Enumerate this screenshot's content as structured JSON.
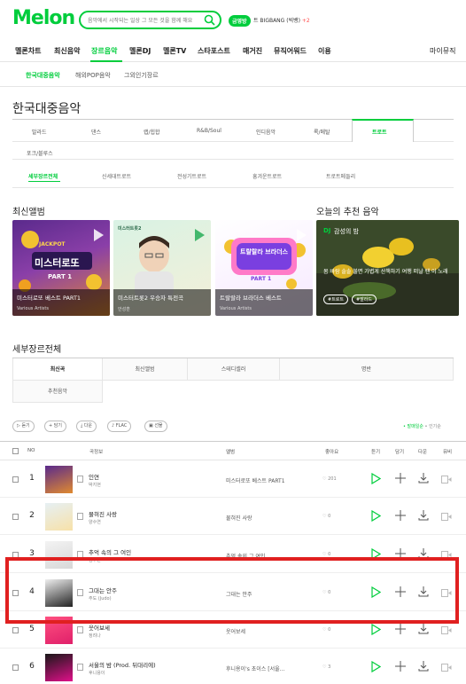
{
  "header": {
    "logo": "Melon",
    "search_placeholder": "음악에서 시작되는 일상 그 모든 것을 함께 해요",
    "promo_badge": "금영방",
    "promo_text": "트 BIGBANG (빅뱅)",
    "promo_new": "+2"
  },
  "gnb": {
    "items": [
      "멜론차트",
      "최신음악",
      "장르음악",
      "멜론DJ",
      "멜론TV",
      "스타포스트",
      "매거진",
      "뮤직어워드",
      "이용"
    ],
    "my_music": "마이뮤직"
  },
  "sub_gnb": {
    "items": [
      "한국대중음악",
      "해외POP음악",
      "그외인기장르"
    ]
  },
  "page_title": "한국대중음악",
  "genres": {
    "row1": [
      "발라드",
      "댄스",
      "랩/힙합",
      "R&B/Soul",
      "인디음악",
      "록/메탈",
      "트로트"
    ],
    "row2": [
      "포크/블루스"
    ]
  },
  "subgenres": [
    "세부장르전체",
    "신세대트로트",
    "전성기트로트",
    "흥겨운트로트",
    "트로트메들리"
  ],
  "latest_albums": {
    "title": "최신앨범",
    "items": [
      {
        "title": "미스터로또 베스트 PART1",
        "artist": "Various Artists",
        "cover_text": "미스터로또",
        "part": "PART 1"
      },
      {
        "title": "미스터트롯2 우승자 특전곡",
        "artist": "안성훈",
        "cover_text": "미스터트롯2"
      },
      {
        "title": "트랄랄라 브라더스 베스트",
        "artist": "Various Artists",
        "cover_text": "트랄랄라 브라더스",
        "part": "PART 1"
      }
    ]
  },
  "recommend": {
    "title": "오늘의 추천 음악",
    "dj_label": "DJ",
    "dj_title": "감성의 밤",
    "desc": "봄 바람 솔솔 불면 가볍게 산책하기 여행 떠날 땐 이 노래",
    "tag1": "#트로트",
    "tag2": "#발라드"
  },
  "detail": {
    "title": "세부장르전체",
    "tabs": [
      "최신곡",
      "최신앨범",
      "스테디셀러",
      "명반",
      "추천음악"
    ]
  },
  "toolbar": {
    "buttons": [
      "듣기",
      "담기",
      "다운",
      "FLAC",
      "선물"
    ],
    "sort_on": "• 발매일순",
    "sort_off": "• 인기순"
  },
  "table": {
    "headers": [
      "NO",
      "곡정보",
      "앨범",
      "좋아요",
      "듣기",
      "담기",
      "다운",
      "뮤비"
    ],
    "rows": [
      {
        "rank": "1",
        "title": "인연",
        "artist": "박지현",
        "album": "미스터로또 베스트 PART1",
        "likes": "201"
      },
      {
        "rank": "2",
        "title": "물혀진 사랑",
        "artist": "양수연",
        "album": "물혀진 사랑",
        "likes": "0"
      },
      {
        "rank": "3",
        "title": "추억 속의 그 여인",
        "artist": "김수한",
        "album": "추억 속의 그 여인",
        "likes": "0"
      },
      {
        "rank": "4",
        "title": "그대는 안주",
        "artist": "주도 (Judo)",
        "album": "그대는 안주",
        "likes": "0"
      },
      {
        "rank": "5",
        "title": "웃어보세",
        "artist": "정려나",
        "album": "웃어보세",
        "likes": "0"
      },
      {
        "rank": "6",
        "title": "서울의 밤 (Prod. 뒤대리에)",
        "artist": "후니용이",
        "album": "후니용이's 초이스 [서울...",
        "likes": "3"
      }
    ]
  },
  "colors": {
    "brand": "#00cd3c",
    "highlight": "#e02020"
  }
}
